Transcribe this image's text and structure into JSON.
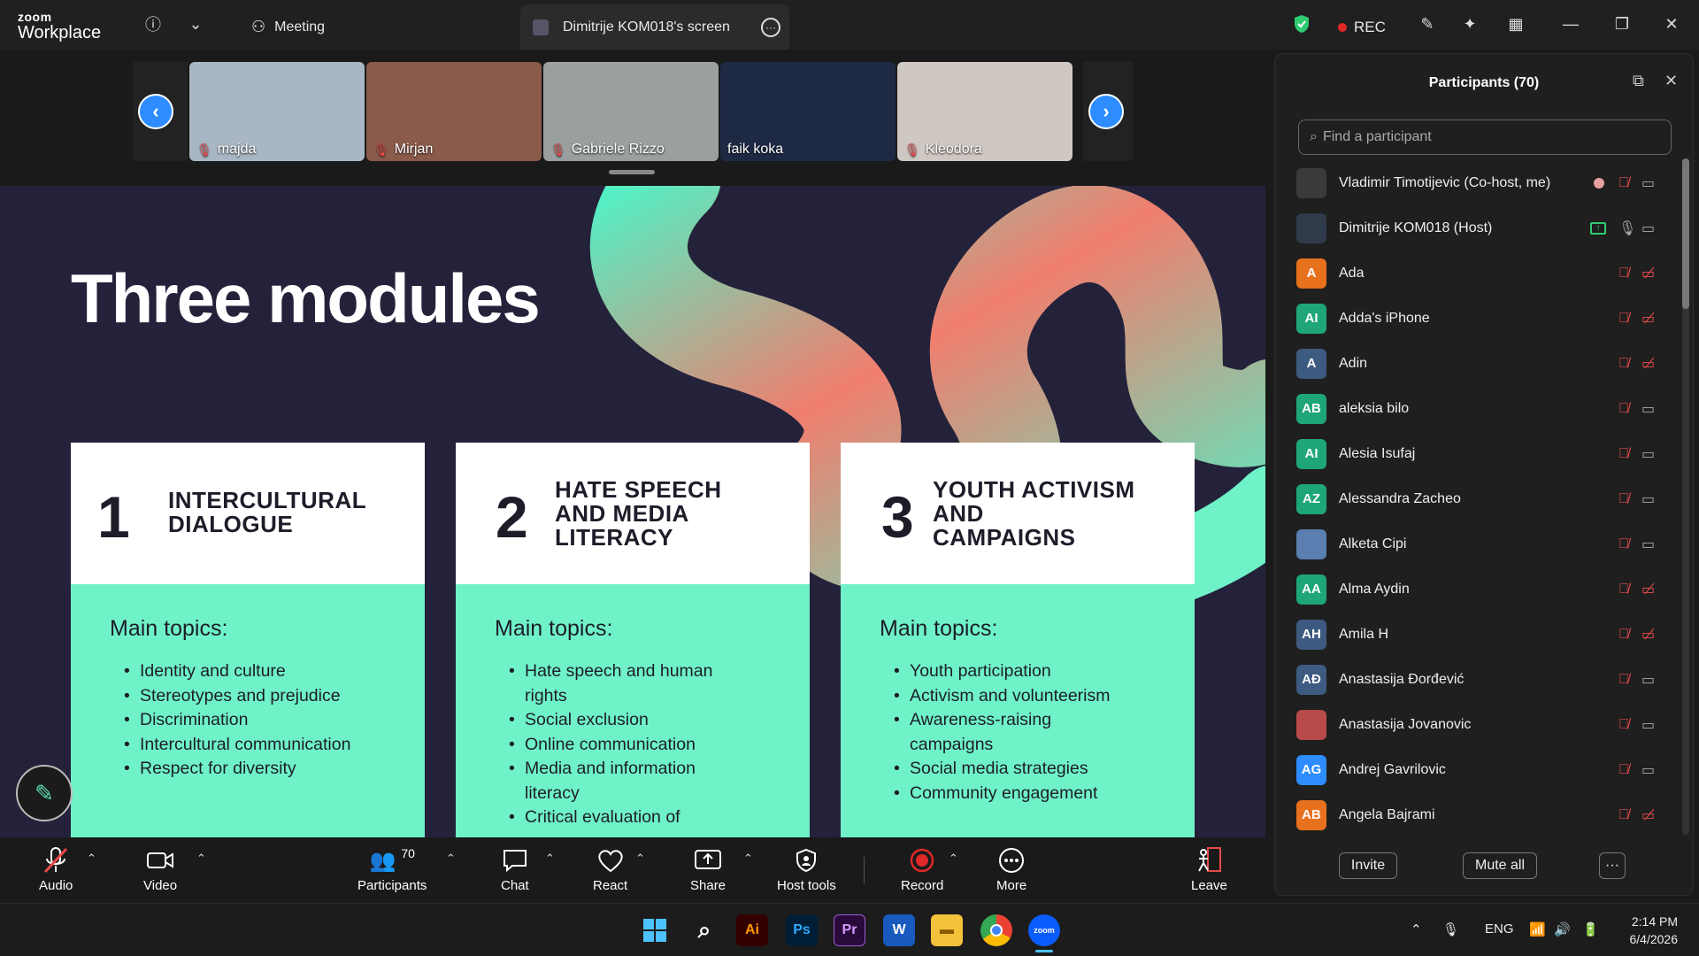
{
  "titlebar": {
    "logo_top": "zoom",
    "logo_bottom": "Workplace",
    "tab_meeting": "Meeting",
    "tab_screen": "Dimitrije KOM018's screen",
    "rec_label": "REC"
  },
  "thumbnails": [
    {
      "name": "majda",
      "bg": "#a9b7c4"
    },
    {
      "name": "Mirjan",
      "bg": "#8a5a4a"
    },
    {
      "name": "Gabriele Rizzo",
      "bg": "#9aa0a0"
    },
    {
      "name": "faik koka",
      "bg": "#1e2a44"
    },
    {
      "name": "Kleodora",
      "bg": "#cfc7c2"
    }
  ],
  "slide": {
    "title": "Three modules",
    "topics_heading": "Main topics:",
    "cards": [
      {
        "num": "1",
        "title": [
          "INTERCULTURAL",
          "DIALOGUE"
        ],
        "topics": [
          "Identity and culture",
          "Stereotypes and prejudice",
          "Discrimination",
          "Intercultural communication",
          "Respect for diversity"
        ]
      },
      {
        "num": "2",
        "title": [
          "HATE SPEECH",
          "AND MEDIA",
          "LITERACY"
        ],
        "topics": [
          "Hate speech and human rights",
          "Social exclusion",
          "Online communication",
          "Media and information literacy",
          "Critical evaluation of"
        ]
      },
      {
        "num": "3",
        "title": [
          "YOUTH ACTIVISM",
          "AND",
          "CAMPAIGNS"
        ],
        "topics": [
          "Youth participation",
          "Activism and volunteerism",
          "Awareness-raising campaigns",
          "Social media strategies",
          "Community engagement"
        ]
      }
    ]
  },
  "toolbar": {
    "audio": "Audio",
    "video": "Video",
    "participants": "Participants",
    "participants_count": "70",
    "chat": "Chat",
    "react": "React",
    "share": "Share",
    "host_tools": "Host tools",
    "record": "Record",
    "more": "More",
    "leave": "Leave"
  },
  "panel": {
    "title": "Participants (70)",
    "search_placeholder": "Find a participant",
    "invite": "Invite",
    "mute_all": "Mute all",
    "participants": [
      {
        "name": "Vladimir Timotijevic (Co-host, me)",
        "initials": "",
        "color": "#3a3a3a",
        "mic": "off",
        "video": "on",
        "extra": "record-dot"
      },
      {
        "name": "Dimitrije KOM018 (Host)",
        "initials": "",
        "color": "#2f3a4a",
        "mic": "on",
        "video": "on",
        "extra": "share"
      },
      {
        "name": "Ada",
        "initials": "A",
        "color": "#e8711e",
        "mic": "off",
        "video": "off"
      },
      {
        "name": "Adda's iPhone",
        "initials": "AI",
        "color": "#1ea67a",
        "mic": "off",
        "video": "off"
      },
      {
        "name": "Adin",
        "initials": "A",
        "color": "#3d5a80",
        "mic": "off",
        "video": "off"
      },
      {
        "name": "aleksia bilo",
        "initials": "AB",
        "color": "#1ea67a",
        "mic": "off",
        "video": "on"
      },
      {
        "name": "Alesia Isufaj",
        "initials": "AI",
        "color": "#1ea67a",
        "mic": "off",
        "video": "on"
      },
      {
        "name": "Alessandra Zacheo",
        "initials": "AZ",
        "color": "#1ea67a",
        "mic": "off",
        "video": "on"
      },
      {
        "name": "Alketa Cipi",
        "initials": "",
        "color": "#5a7fb0",
        "mic": "off",
        "video": "on"
      },
      {
        "name": "Alma Aydin",
        "initials": "AA",
        "color": "#1ea67a",
        "mic": "off",
        "video": "off"
      },
      {
        "name": "Amila H",
        "initials": "AH",
        "color": "#3d5a80",
        "mic": "off",
        "video": "off"
      },
      {
        "name": "Anastasija Đorđević",
        "initials": "AĐ",
        "color": "#3d5a80",
        "mic": "off",
        "video": "on"
      },
      {
        "name": "Anastasija Jovanovic",
        "initials": "",
        "color": "#b94a4a",
        "mic": "off",
        "video": "on"
      },
      {
        "name": "Andrej Gavrilovic",
        "initials": "AG",
        "color": "#2d8cff",
        "mic": "off",
        "video": "on"
      },
      {
        "name": "Angela Bajrami",
        "initials": "AB",
        "color": "#e8711e",
        "mic": "off",
        "video": "off"
      }
    ]
  },
  "taskbar": {
    "lang": "ENG",
    "time": "2:14 PM",
    "date": "6/4/2026"
  }
}
